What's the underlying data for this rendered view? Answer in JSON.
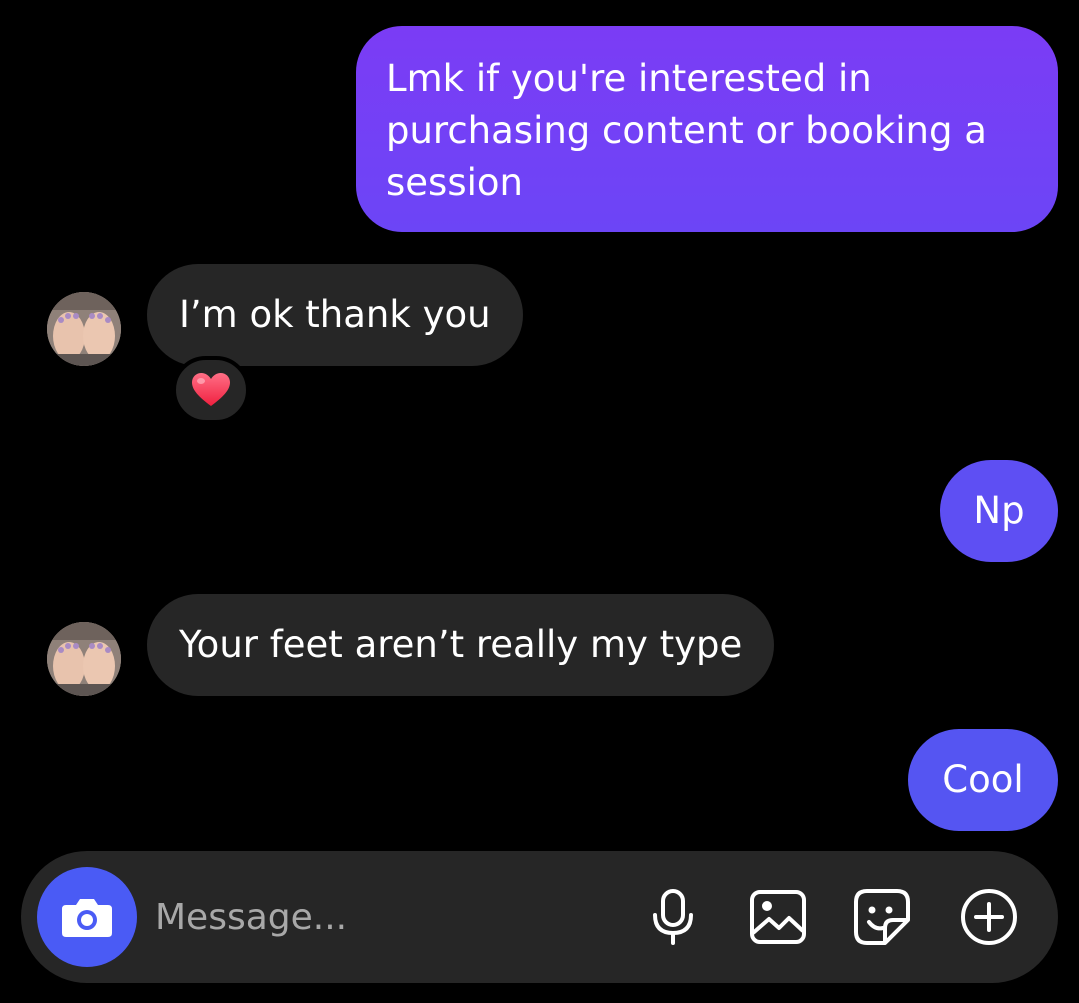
{
  "messages": [
    {
      "sender": "me",
      "text": "Lmk if you're interested in purchasing content or booking a session"
    },
    {
      "sender": "them",
      "text": "I’m ok thank you",
      "reaction": "heart"
    },
    {
      "sender": "me",
      "text": "Np"
    },
    {
      "sender": "them",
      "text": "Your feet aren’t really my type"
    },
    {
      "sender": "me",
      "text": "Cool"
    }
  ],
  "composer": {
    "placeholder": "Message...",
    "icons": [
      "camera-icon",
      "microphone-icon",
      "gallery-icon",
      "sticker-icon",
      "plus-circle-icon"
    ]
  },
  "colors": {
    "background": "#000000",
    "sent_bubble_top": "#7b3cf5",
    "sent_bubble_bottom": "#5555f2",
    "received_bubble": "#262626",
    "camera_button": "#4a5bf5",
    "reaction_heart": "#ff3b5c"
  }
}
